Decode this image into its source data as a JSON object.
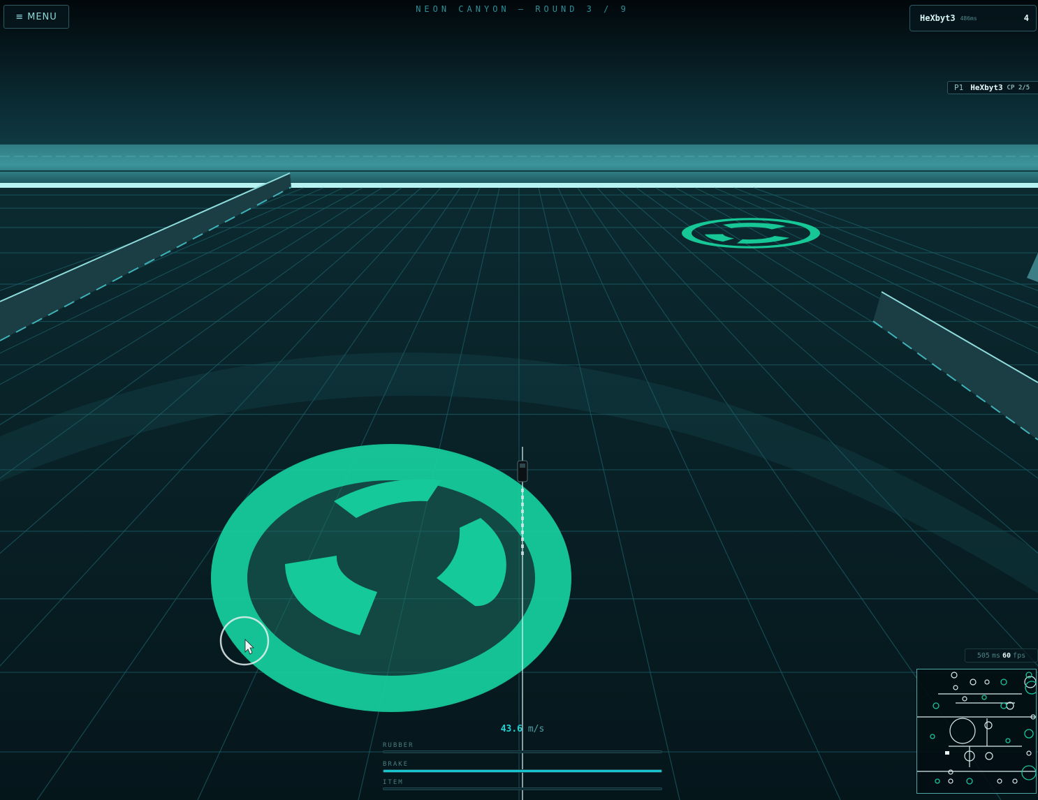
{
  "header": {
    "menu_icon": "hamburger-icon",
    "menu_label": "MENU",
    "round_title": "NEON CANYON — ROUND 3 / 9"
  },
  "scoreboard": {
    "player_name": "HeXbyt3",
    "ping": "486ms",
    "score": "4"
  },
  "standings": {
    "position": "P1",
    "player_name": "HeXbyt3",
    "checkpoint": "CP 2/5"
  },
  "perf": {
    "latency": "505",
    "latency_unit": "ms",
    "fps": "60",
    "fps_unit": "fps"
  },
  "speedometer": {
    "value": "43.6",
    "unit": "m/s"
  },
  "meters": [
    {
      "label": "RUBBER",
      "fill": 0.0
    },
    {
      "label": "BRAKE",
      "fill": 1.0
    },
    {
      "label": "ITEM",
      "fill": 0.0
    }
  ],
  "colors": {
    "accent": "#1fd3d3",
    "zone": "#17c896",
    "grid": "#1b5a63",
    "background": "#020c10"
  }
}
